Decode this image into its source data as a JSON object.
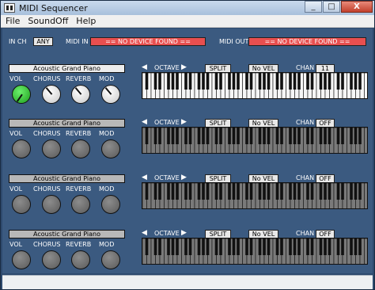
{
  "window": {
    "title": "MIDI Sequencer",
    "minimize_label": "_",
    "maximize_label": "□",
    "close_label": "X"
  },
  "menu": [
    "File",
    "SoundOff",
    "Help"
  ],
  "top_bar": {
    "in_ch_label": "IN CH",
    "in_ch_value": "ANY",
    "midi_in_label": "MIDI IN",
    "midi_in_value": "== NO DEVICE FOUND ==",
    "midi_out_label": "MIDI OUT",
    "midi_out_value": "== NO DEVICE FOUND =="
  },
  "colors": {
    "panel_bg": "#3b5a80",
    "device_error": "#e84f4f",
    "active_knob": "#2ecc2e"
  },
  "channels": [
    {
      "instrument": "Acoustic Grand Piano",
      "octave_label": "OCTAVE",
      "split_label": "SPLIT",
      "vel_label": "No VEL",
      "chan_label": "CHAN",
      "chan_value": "11",
      "active": true,
      "knobs": [
        {
          "label": "VOL",
          "style": "green"
        },
        {
          "label": "CHORUS",
          "style": "white"
        },
        {
          "label": "REVERB",
          "style": "white"
        },
        {
          "label": "MOD",
          "style": "white"
        }
      ]
    },
    {
      "instrument": "Acoustic Grand Piano",
      "octave_label": "OCTAVE",
      "split_label": "SPLIT",
      "vel_label": "No VEL",
      "chan_label": "CHAN",
      "chan_value": "OFF",
      "active": false,
      "knobs": [
        {
          "label": "VOL",
          "style": "grey"
        },
        {
          "label": "CHORUS",
          "style": "grey"
        },
        {
          "label": "REVERB",
          "style": "grey"
        },
        {
          "label": "MOD",
          "style": "grey"
        }
      ]
    },
    {
      "instrument": "Acoustic Grand Piano",
      "octave_label": "OCTAVE",
      "split_label": "SPLIT",
      "vel_label": "No VEL",
      "chan_label": "CHAN",
      "chan_value": "OFF",
      "active": false,
      "knobs": [
        {
          "label": "VOL",
          "style": "grey"
        },
        {
          "label": "CHORUS",
          "style": "grey"
        },
        {
          "label": "REVERB",
          "style": "grey"
        },
        {
          "label": "MOD",
          "style": "grey"
        }
      ]
    },
    {
      "instrument": "Acoustic Grand Piano",
      "octave_label": "OCTAVE",
      "split_label": "SPLIT",
      "vel_label": "No VEL",
      "chan_label": "CHAN",
      "chan_value": "OFF",
      "active": false,
      "knobs": [
        {
          "label": "VOL",
          "style": "grey"
        },
        {
          "label": "CHORUS",
          "style": "grey"
        },
        {
          "label": "REVERB",
          "style": "grey"
        },
        {
          "label": "MOD",
          "style": "grey"
        }
      ]
    }
  ]
}
